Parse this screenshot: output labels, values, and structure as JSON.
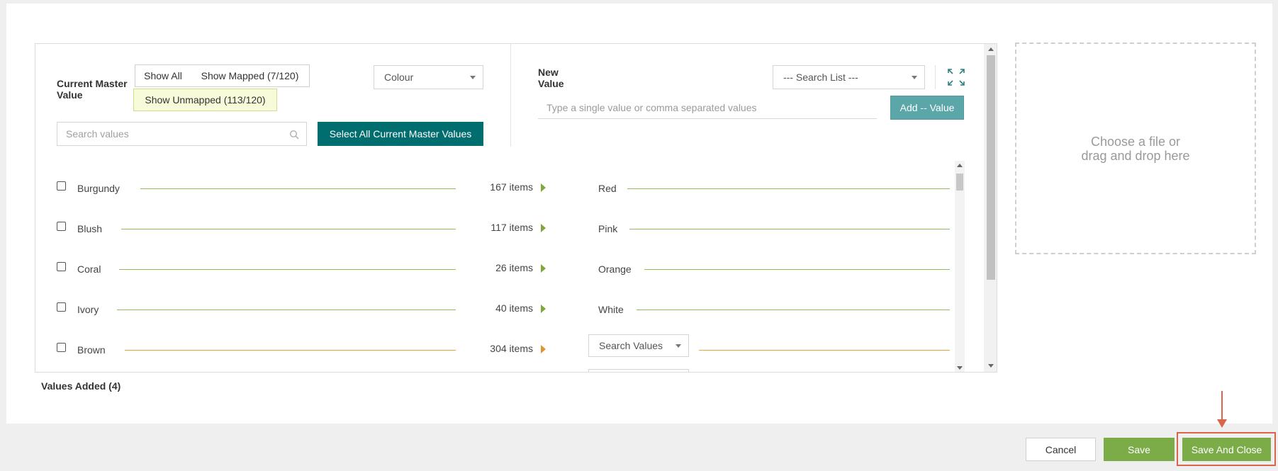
{
  "filters": {
    "current_master_label": "Current Master Value",
    "show_all": "Show All",
    "show_mapped": "Show Mapped (7/120)",
    "show_unmapped": "Show Unmapped (113/120)",
    "attribute_select": "Colour",
    "search_placeholder": "Search values",
    "select_all_label": "Select All Current Master Values"
  },
  "new_value": {
    "label": "New Value",
    "search_list": "--- Search List ---",
    "input_placeholder": "Type a single value or comma separated values",
    "add_button": "Add -- Value"
  },
  "rows": [
    {
      "name": "Burgundy",
      "count": "167 items",
      "target": "Red",
      "status": "mapped"
    },
    {
      "name": "Blush",
      "count": "117 items",
      "target": "Pink",
      "status": "mapped"
    },
    {
      "name": "Coral",
      "count": "26 items",
      "target": "Orange",
      "status": "mapped"
    },
    {
      "name": "Ivory",
      "count": "40 items",
      "target": "White",
      "status": "mapped"
    },
    {
      "name": "Brown",
      "count": "304 items",
      "target": "Search Values",
      "status": "unmapped"
    }
  ],
  "dropzone": {
    "line1": "Choose a file or",
    "line2": "drag and drop here"
  },
  "values_added": "Values Added (4)",
  "footer": {
    "cancel": "Cancel",
    "save": "Save",
    "save_and_close": "Save And Close"
  },
  "colors": {
    "mapped_line": "#8fbd58",
    "unmapped_line": "#e8a23a",
    "teal": "#006d6f",
    "save_green": "#7cac48",
    "highlight": "#d9664a"
  }
}
